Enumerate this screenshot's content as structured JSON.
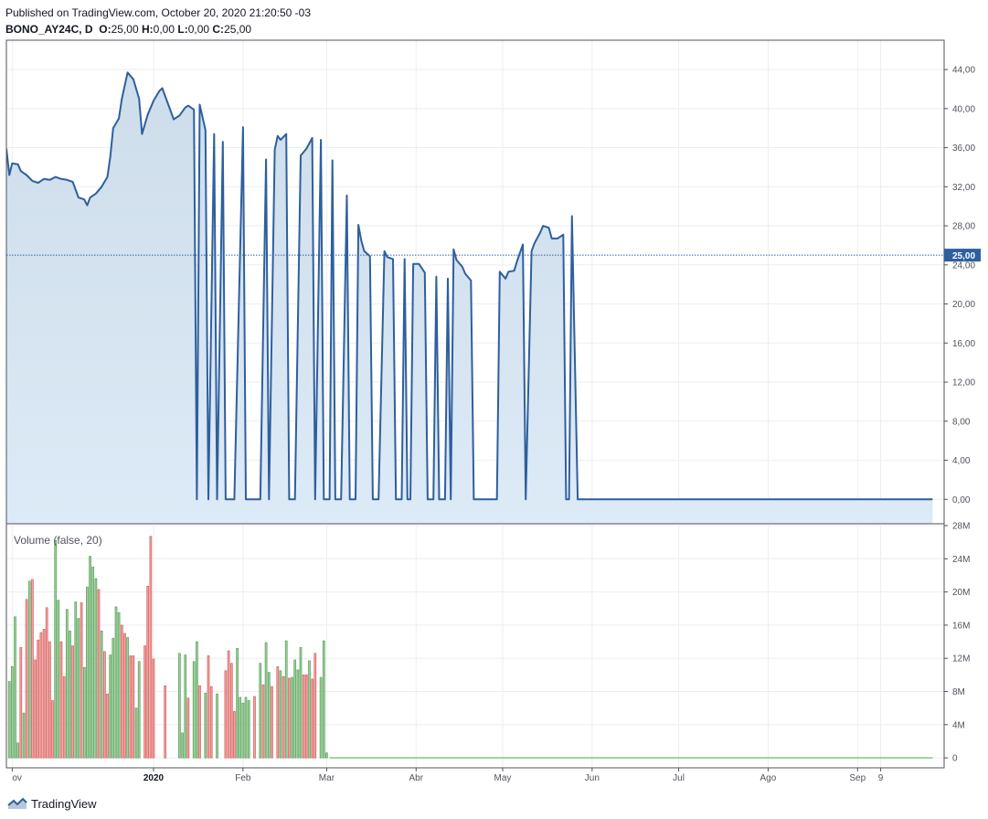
{
  "header": {
    "published": "Published on TradingView.com, October 20, 2020 21:20:50 -03",
    "symbol": "BONO_AY24C, D",
    "ohlc": {
      "o_label": "O:",
      "o": "25,00",
      "h_label": "H:",
      "h": "0,00",
      "l_label": "L:",
      "l": "0,00",
      "c_label": "C:",
      "c": "25,00"
    }
  },
  "brand": {
    "name": "TradingView"
  },
  "colors": {
    "line": "#2e5f9e",
    "area_top": "#cddde9",
    "area_bottom": "#ddeaf7",
    "vol_up": "#9bd19b",
    "vol_up_border": "#5a9e5a",
    "vol_down": "#f7a09d",
    "vol_down_border": "#d06060",
    "last_price_bg": "#2e5f9e",
    "grid": "#eceef2",
    "border": "#50535e"
  },
  "chart_data": [
    {
      "type": "area",
      "title": "",
      "axis": "price",
      "ylim": [
        -2.5,
        47
      ],
      "yticks": [
        "0,00",
        "4,00",
        "8,00",
        "12,00",
        "16,00",
        "20,00",
        "24,00",
        "28,00",
        "32,00",
        "36,00",
        "40,00",
        "44,00"
      ],
      "last_price_label": "25,00",
      "last_price": 25,
      "x_ticks": [
        {
          "label": "ov",
          "day": -49
        },
        {
          "label": "2020",
          "day": 0,
          "bold": true
        },
        {
          "label": "Feb",
          "day": 31
        },
        {
          "label": "Mar",
          "day": 60
        },
        {
          "label": "Abr",
          "day": 91
        },
        {
          "label": "May",
          "day": 121
        },
        {
          "label": "Jun",
          "day": 152
        },
        {
          "label": "Jul",
          "day": 182
        },
        {
          "label": "Ago",
          "day": 213
        },
        {
          "label": "Sep",
          "day": 244
        },
        {
          "label": "9",
          "day": 252
        }
      ],
      "x_range_days": [
        -51,
        274
      ],
      "points": [
        [
          -51,
          35.9
        ],
        [
          -50,
          33.2
        ],
        [
          -49,
          34.4
        ],
        [
          -47,
          34.3
        ],
        [
          -46,
          33.6
        ],
        [
          -44,
          33.2
        ],
        [
          -42,
          32.6
        ],
        [
          -40,
          32.4
        ],
        [
          -38,
          32.8
        ],
        [
          -36,
          32.7
        ],
        [
          -34,
          33.0
        ],
        [
          -32,
          32.8
        ],
        [
          -30,
          32.7
        ],
        [
          -28,
          32.5
        ],
        [
          -26,
          30.9
        ],
        [
          -24,
          30.7
        ],
        [
          -23,
          30.1
        ],
        [
          -22,
          30.9
        ],
        [
          -20,
          31.3
        ],
        [
          -18,
          32.0
        ],
        [
          -16,
          33.0
        ],
        [
          -15,
          35.0
        ],
        [
          -14,
          38.0
        ],
        [
          -12,
          39.0
        ],
        [
          -11,
          41.0
        ],
        [
          -9,
          43.7
        ],
        [
          -7,
          43.0
        ],
        [
          -5,
          41.0
        ],
        [
          -4,
          37.4
        ],
        [
          -2,
          39.4
        ],
        [
          0,
          40.8
        ],
        [
          2,
          41.8
        ],
        [
          3,
          42.1
        ],
        [
          5,
          40.5
        ],
        [
          7,
          38.9
        ],
        [
          9,
          39.3
        ],
        [
          11,
          40.1
        ],
        [
          12,
          40.3
        ],
        [
          14,
          39.9
        ],
        [
          15,
          0
        ],
        [
          16,
          40.4
        ],
        [
          18,
          37.8
        ],
        [
          19,
          0
        ],
        [
          21,
          37.4
        ],
        [
          22,
          0
        ],
        [
          24,
          36.6
        ],
        [
          25,
          0
        ],
        [
          28,
          0
        ],
        [
          31,
          38.1
        ],
        [
          32,
          0
        ],
        [
          35,
          0
        ],
        [
          37,
          0
        ],
        [
          39,
          34.8
        ],
        [
          40,
          0
        ],
        [
          42,
          35.8
        ],
        [
          43,
          37.2
        ],
        [
          44,
          36.8
        ],
        [
          46,
          37.4
        ],
        [
          47,
          0
        ],
        [
          49,
          0
        ],
        [
          51,
          35.2
        ],
        [
          53,
          35.9
        ],
        [
          55,
          37.0
        ],
        [
          56,
          0
        ],
        [
          58,
          36.8
        ],
        [
          59,
          0
        ],
        [
          61,
          0
        ],
        [
          62,
          34.7
        ],
        [
          63,
          0
        ],
        [
          65,
          0
        ],
        [
          67,
          31.1
        ],
        [
          68,
          0
        ],
        [
          70,
          0
        ],
        [
          71,
          28.1
        ],
        [
          72,
          26.5
        ],
        [
          73,
          25.4
        ],
        [
          75,
          24.9
        ],
        [
          76,
          0
        ],
        [
          78,
          0
        ],
        [
          80,
          25.4
        ],
        [
          81,
          24.8
        ],
        [
          83,
          24.6
        ],
        [
          84,
          0
        ],
        [
          86,
          0
        ],
        [
          87,
          24.6
        ],
        [
          88,
          0
        ],
        [
          89,
          0
        ],
        [
          90,
          24.1
        ],
        [
          92,
          24.1
        ],
        [
          94,
          23.2
        ],
        [
          95,
          0
        ],
        [
          97,
          0
        ],
        [
          98,
          22.8
        ],
        [
          99,
          0
        ],
        [
          101,
          0
        ],
        [
          102,
          22.6
        ],
        [
          103,
          0
        ],
        [
          104,
          25.6
        ],
        [
          105,
          24.5
        ],
        [
          107,
          23.8
        ],
        [
          108,
          23.1
        ],
        [
          110,
          22.4
        ],
        [
          111,
          0
        ],
        [
          119,
          0
        ],
        [
          120,
          23.3
        ],
        [
          122,
          22.6
        ],
        [
          123,
          23.3
        ],
        [
          125,
          23.4
        ],
        [
          126,
          24.4
        ],
        [
          128,
          26.1
        ],
        [
          129,
          0
        ],
        [
          131,
          25.4
        ],
        [
          132,
          26.2
        ],
        [
          134,
          27.3
        ],
        [
          135,
          28.0
        ],
        [
          137,
          27.8
        ],
        [
          138,
          26.7
        ],
        [
          140,
          26.7
        ],
        [
          142,
          27.1
        ],
        [
          143,
          0
        ],
        [
          144,
          0
        ],
        [
          145,
          29.0
        ],
        [
          147,
          0
        ],
        [
          270,
          0
        ]
      ]
    },
    {
      "type": "bar",
      "title": "Volume (false, 20)",
      "axis": "volume",
      "ylim": [
        -1.2,
        28
      ],
      "yticks": [
        "0",
        "4M",
        "8M",
        "12M",
        "16M",
        "20M",
        "24M",
        "28M"
      ],
      "bars": [
        [
          -50,
          9.2,
          "up"
        ],
        [
          -49,
          11.0,
          "up"
        ],
        [
          -48,
          17.0,
          "up"
        ],
        [
          -47,
          1.8,
          "up"
        ],
        [
          -46,
          13.3,
          "down"
        ],
        [
          -45,
          5.4,
          "up"
        ],
        [
          -44,
          19.1,
          "down"
        ],
        [
          -43,
          21.3,
          "up"
        ],
        [
          -42,
          21.5,
          "down"
        ],
        [
          -41,
          11.8,
          "down"
        ],
        [
          -40,
          14.2,
          "down"
        ],
        [
          -39,
          15.1,
          "down"
        ],
        [
          -38,
          15.5,
          "down"
        ],
        [
          -37,
          18.1,
          "down"
        ],
        [
          -36,
          14.0,
          "down"
        ],
        [
          -35,
          6.9,
          "down"
        ],
        [
          -34,
          26.2,
          "up"
        ],
        [
          -33,
          19.0,
          "up"
        ],
        [
          -32,
          14.0,
          "down"
        ],
        [
          -31,
          9.8,
          "down"
        ],
        [
          -30,
          17.9,
          "up"
        ],
        [
          -29,
          15.3,
          "up"
        ],
        [
          -28,
          13.5,
          "down"
        ],
        [
          -27,
          18.8,
          "up"
        ],
        [
          -26,
          16.8,
          "up"
        ],
        [
          -25,
          18.7,
          "down"
        ],
        [
          -24,
          10.9,
          "up"
        ],
        [
          -23,
          20.6,
          "up"
        ],
        [
          -22,
          24.3,
          "up"
        ],
        [
          -21,
          23.0,
          "up"
        ],
        [
          -20,
          21.6,
          "up"
        ],
        [
          -19,
          20.3,
          "down"
        ],
        [
          -18,
          15.3,
          "up"
        ],
        [
          -17,
          12.8,
          "down"
        ],
        [
          -16,
          7.7,
          "down"
        ],
        [
          -15,
          12.4,
          "up"
        ],
        [
          -14,
          14.4,
          "up"
        ],
        [
          -13,
          18.2,
          "up"
        ],
        [
          -12,
          17.5,
          "up"
        ],
        [
          -11,
          16.0,
          "down"
        ],
        [
          -10,
          15.0,
          "down"
        ],
        [
          -9,
          14.5,
          "up"
        ],
        [
          -8,
          12.3,
          "down"
        ],
        [
          -7,
          12.3,
          "down"
        ],
        [
          -6,
          6.0,
          "up"
        ],
        [
          -5,
          11.6,
          "up"
        ],
        [
          -3,
          13.5,
          "down"
        ],
        [
          -2,
          20.7,
          "down"
        ],
        [
          -1,
          26.7,
          "down"
        ],
        [
          0,
          11.9,
          "down"
        ],
        [
          4,
          8.7,
          "down"
        ],
        [
          9,
          12.6,
          "up"
        ],
        [
          10,
          3.0,
          "up"
        ],
        [
          11,
          12.4,
          "up"
        ],
        [
          12,
          7.2,
          "down"
        ],
        [
          14,
          11.6,
          "up"
        ],
        [
          15,
          14.0,
          "up"
        ],
        [
          16,
          8.7,
          "down"
        ],
        [
          18,
          7.8,
          "up"
        ],
        [
          19,
          12.3,
          "down"
        ],
        [
          20,
          8.6,
          "down"
        ],
        [
          22,
          7.7,
          "up"
        ],
        [
          25,
          10.5,
          "down"
        ],
        [
          26,
          12.9,
          "down"
        ],
        [
          27,
          11.4,
          "down"
        ],
        [
          28,
          5.6,
          "down"
        ],
        [
          29,
          13.2,
          "up"
        ],
        [
          30,
          7.3,
          "up"
        ],
        [
          31,
          6.6,
          "up"
        ],
        [
          32,
          7.3,
          "up"
        ],
        [
          33,
          6.9,
          "up"
        ],
        [
          35,
          7.4,
          "down"
        ],
        [
          37,
          11.4,
          "up"
        ],
        [
          38,
          8.8,
          "down"
        ],
        [
          39,
          13.9,
          "up"
        ],
        [
          40,
          10.3,
          "up"
        ],
        [
          41,
          8.6,
          "down"
        ],
        [
          43,
          11.0,
          "down"
        ],
        [
          44,
          10.5,
          "up"
        ],
        [
          45,
          9.8,
          "down"
        ],
        [
          46,
          14.1,
          "up"
        ],
        [
          47,
          9.6,
          "down"
        ],
        [
          48,
          9.7,
          "up"
        ],
        [
          49,
          11.8,
          "up"
        ],
        [
          50,
          10.6,
          "up"
        ],
        [
          51,
          13.3,
          "up"
        ],
        [
          52,
          10.0,
          "down"
        ],
        [
          53,
          10.0,
          "down"
        ],
        [
          54,
          11.7,
          "up"
        ],
        [
          55,
          9.5,
          "down"
        ],
        [
          56,
          12.6,
          "down"
        ],
        [
          58,
          9.7,
          "up"
        ],
        [
          59,
          14.1,
          "up"
        ],
        [
          60,
          0.6,
          "up"
        ]
      ]
    }
  ]
}
